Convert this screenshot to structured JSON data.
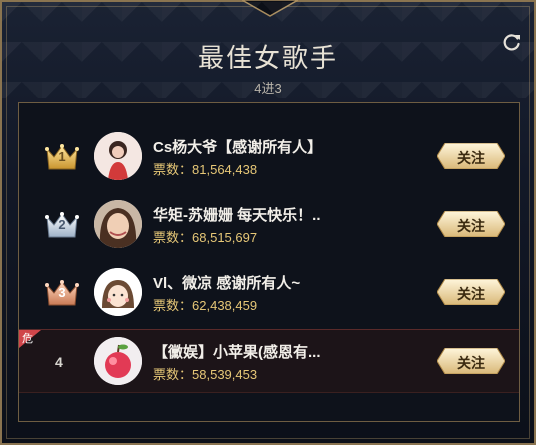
{
  "header": {
    "title": "最佳女歌手",
    "subtitle": "4进3"
  },
  "icons": {
    "refresh": "refresh-icon",
    "crown": "crown-icon"
  },
  "colors": {
    "gold": "#e6c777",
    "danger": "#d0454a",
    "border": "#8a7450"
  },
  "list": {
    "vote_label": "票数：",
    "follow_label": "关注",
    "danger_badge": "危",
    "entries": [
      {
        "rank": "1",
        "name": "Cs杨大爷【感谢所有人】",
        "votes": "81,564,438",
        "crown": "gold"
      },
      {
        "rank": "2",
        "name": "华矩-苏姗姗 每天快乐！..",
        "votes": "68,515,697",
        "crown": "silver"
      },
      {
        "rank": "3",
        "name": "Vl、微凉 感谢所有人~",
        "votes": "62,438,459",
        "crown": "bronze"
      },
      {
        "rank": "4",
        "name": "【黴娱】小苹果(感恩有...",
        "votes": "58,539,453",
        "crown": "none"
      }
    ]
  }
}
